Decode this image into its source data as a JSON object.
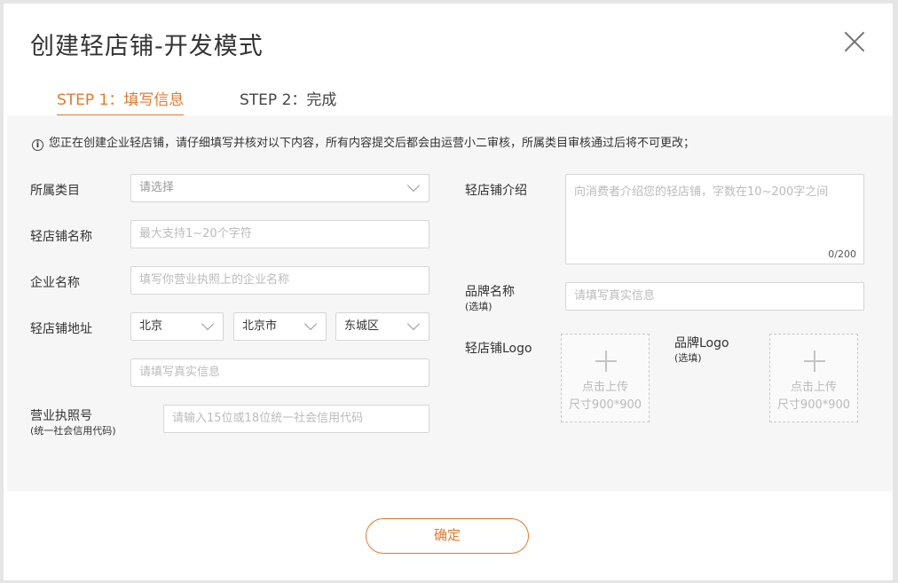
{
  "modal": {
    "title": "创建轻店铺-开发模式",
    "close_icon": "close-icon"
  },
  "steps": [
    {
      "label": "STEP 1：填写信息",
      "active": true
    },
    {
      "label": "STEP 2：完成",
      "active": false
    }
  ],
  "notice": "您正在创建企业轻店铺，请仔细填写并核对以下内容，所有内容提交后都会由运营小二审核，所属类目审核通过后将不可更改；",
  "form": {
    "category": {
      "label": "所属类目",
      "value": "请选择"
    },
    "shop_name": {
      "label": "轻店铺名称",
      "placeholder": "最大支持1~20个字符"
    },
    "company_name": {
      "label": "企业名称",
      "placeholder": "填写你营业执照上的企业名称"
    },
    "address": {
      "label": "轻店铺地址",
      "province": "北京",
      "city": "北京市",
      "district": "东城区",
      "detail_placeholder": "请填写真实信息"
    },
    "license": {
      "label": "营业执照号",
      "sublabel": "(统一社会信用代码)",
      "placeholder": "请输入15位或18位统一社会信用代码"
    },
    "intro": {
      "label": "轻店铺介绍",
      "placeholder": "向消费者介绍您的轻店铺，字数在10~200字之间",
      "counter": "0/200"
    },
    "brand_name": {
      "label": "品牌名称",
      "sublabel": "(选填)",
      "placeholder": "请填写真实信息"
    },
    "shop_logo": {
      "label": "轻店铺Logo",
      "upload_line1": "点击上传",
      "upload_line2": "尺寸900*900"
    },
    "brand_logo": {
      "label": "品牌Logo",
      "sublabel": "(选填)",
      "upload_line1": "点击上传",
      "upload_line2": "尺寸900*900"
    }
  },
  "confirm_label": "确定",
  "accent_color": "#e07a2f"
}
